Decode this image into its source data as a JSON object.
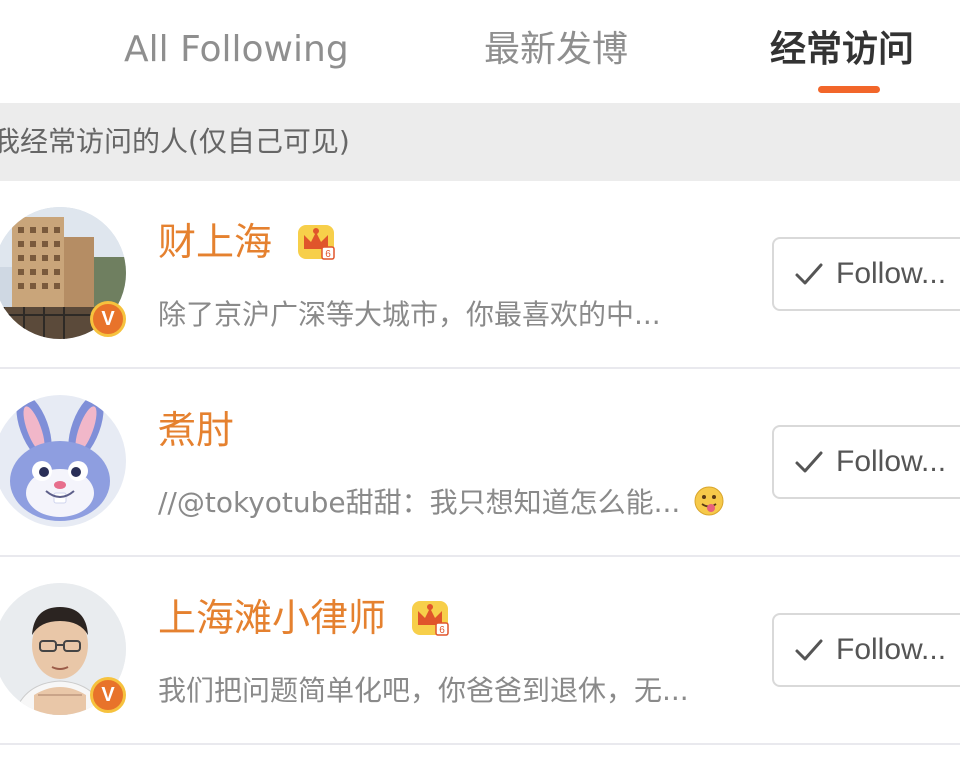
{
  "tabs": [
    {
      "label": "All Following",
      "active": false
    },
    {
      "label": "最新发博",
      "active": false
    },
    {
      "label": "经常访问",
      "active": true
    }
  ],
  "accent_color": "#f2662a",
  "name_color": "#e5812f",
  "section": {
    "title": "我经常访问的人(仅自己可见)"
  },
  "users": [
    {
      "name": "财上海",
      "description": "除了京沪广深等大城市，你最喜欢的中...",
      "verified_badge": "V",
      "has_crown": true,
      "follow_label": "Follow...",
      "avatar": "building-photo"
    },
    {
      "name": "煮肘",
      "description": "//@tokyotube甜甜：我只想知道怎么能...",
      "verified_badge": "",
      "has_crown": false,
      "has_emoji": true,
      "follow_label": "Follow...",
      "avatar": "blue-rabbit"
    },
    {
      "name": "上海滩小律师",
      "description": "我们把问题简单化吧，你爸爸到退休，无...",
      "verified_badge": "V",
      "has_crown": true,
      "follow_label": "Follow...",
      "avatar": "man-with-glasses"
    }
  ]
}
